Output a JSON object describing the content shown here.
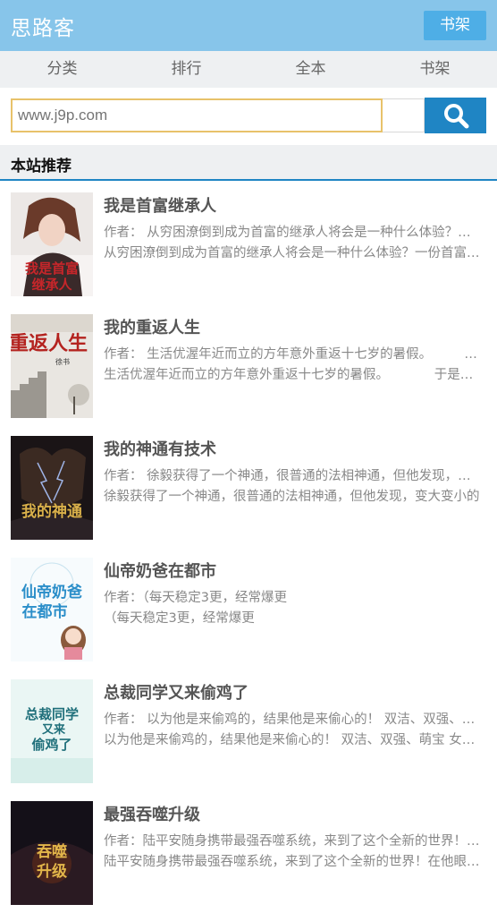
{
  "header": {
    "title": "思路客",
    "shelf_button": "书架"
  },
  "nav": {
    "items": [
      "分类",
      "排行",
      "全本",
      "书架"
    ]
  },
  "search": {
    "placeholder": "www.j9p.com"
  },
  "section": {
    "title": "本站推荐"
  },
  "books": [
    {
      "title": "我是首富继承人",
      "author_line": "作者： 从穷困潦倒到成为首富的继承人将会是一种什么体验？一份首富的",
      "desc": "从穷困潦倒到成为首富的继承人将会是一种什么体验？一份首富的遗嘱",
      "cover_text": "我是首富继承人"
    },
    {
      "title": "我的重返人生",
      "author_line": "作者： 生活优渥年近而立的方年意外重返十七岁的暑假。　　　　于是，",
      "desc": "生活优渥年近而立的方年意外重返十七岁的暑假。　　　　于是，他",
      "cover_text": "重返人生"
    },
    {
      "title": "我的神通有技术",
      "author_line": "作者： 徐毅获得了一个神通，很普通的法相神通，但他发现，变大变小",
      "desc": "徐毅获得了一个神通，很普通的法相神通，但他发现，变大变小的",
      "cover_text": "我的神通"
    },
    {
      "title": "仙帝奶爸在都市",
      "author_line": "作者：（每天稳定3更，经常爆更",
      "desc": "（每天稳定3更，经常爆更",
      "cover_text": "仙帝奶爸在都市"
    },
    {
      "title": "总裁同学又来偷鸡了",
      "author_line": "作者： 以为他是来偷鸡的，结果他是来偷心的！ 双洁、双强、萌宝 女主",
      "desc": "以为他是来偷鸡的，结果他是来偷心的！ 双洁、双强、萌宝 女主偏",
      "cover_text": "总裁同学又来偷鸡了"
    },
    {
      "title": "最强吞噬升级",
      "author_line": "作者：陆平安随身携带最强吞噬系统，来到了这个全新的世界！在他眼中",
      "desc": "陆平安随身携带最强吞噬系统，来到了这个全新的世界！在他眼中，",
      "cover_text": "吞噬升级"
    }
  ],
  "colors": {
    "topbar": "#87c5ea",
    "shelf_button": "#4eaee6",
    "search_button": "#1f85c4",
    "search_border": "#e8c26a",
    "nav_background": "#eef0f2"
  },
  "icons": {
    "search": "search-icon"
  }
}
